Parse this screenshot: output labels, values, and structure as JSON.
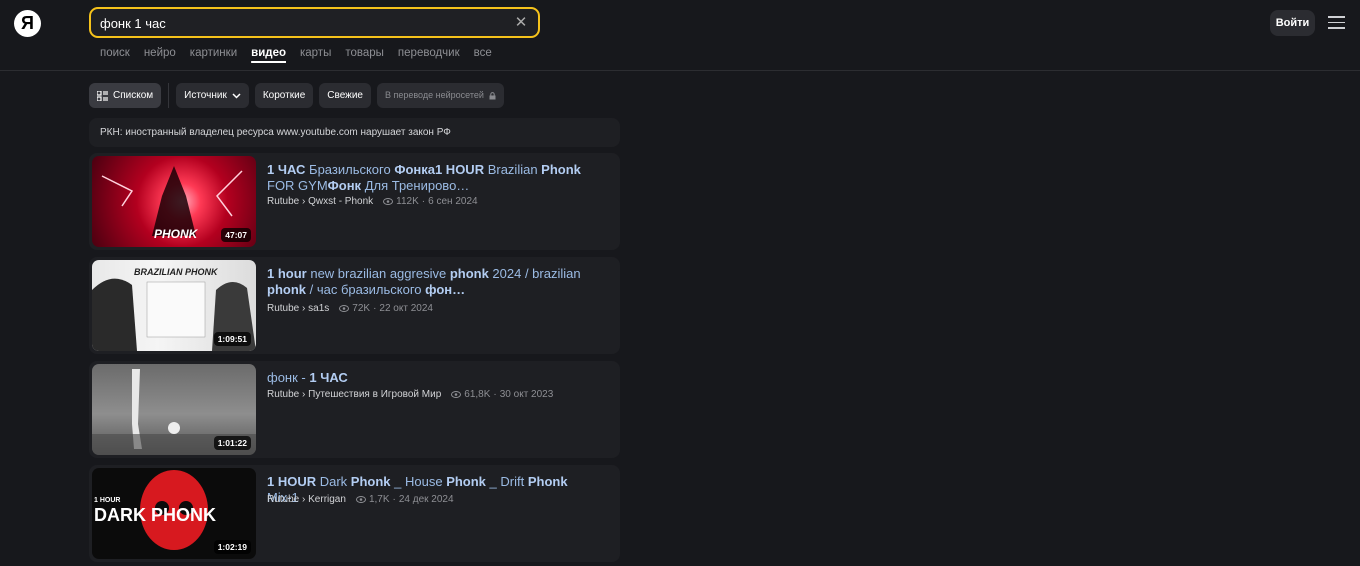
{
  "logo": "Я",
  "search": {
    "value": "фонк 1 час",
    "clear_icon": "✕"
  },
  "tabs": [
    "поиск",
    "нейро",
    "картинки",
    "видео",
    "карты",
    "товары",
    "переводчик",
    "все"
  ],
  "active_tab": "видео",
  "header": {
    "login_label": "Войти"
  },
  "filters": {
    "list_label": "Списком",
    "source_label": "Источник",
    "short_label": "Короткие",
    "fresh_label": "Свежие",
    "neural_label": "В переводе нейросетей"
  },
  "notice": "РКН: иностранный владелец ресурса www.youtube.com нарушает закон РФ",
  "results": [
    {
      "title_parts": [
        [
          "1 ЧАС",
          true
        ],
        [
          " Бразильского ",
          false
        ],
        [
          "Фонка1 HOUR",
          true
        ],
        [
          " Brazilian ",
          false
        ],
        [
          "Phonk",
          true
        ],
        [
          " FOR GYM",
          false
        ],
        [
          "Фонк",
          true
        ],
        [
          " Для Тренирово…",
          false
        ]
      ],
      "source": "Rutube › Qwxst - Phonk",
      "views": "112K",
      "date": "6 сен 2024",
      "duration": "47:07",
      "thumb_text": "PHONK"
    },
    {
      "title_parts": [
        [
          "1 hour",
          true
        ],
        [
          " new brazilian aggresive ",
          false
        ],
        [
          "phonk",
          true
        ],
        [
          " 2024 / brazilian ",
          false
        ],
        [
          "phonk",
          true
        ],
        [
          " / час бразильского ",
          false
        ],
        [
          "фон…",
          true
        ]
      ],
      "source": "Rutube › sa1s",
      "views": "72K",
      "date": "22 окт 2024",
      "duration": "1:09:51",
      "thumb_text": "BRAZILIAN PHONK"
    },
    {
      "title_parts": [
        [
          "фонк",
          false
        ],
        [
          " - ",
          false
        ],
        [
          "1 ЧАС",
          true
        ]
      ],
      "source": "Rutube › Путешествия в Игровой Мир",
      "views": "61,8K",
      "date": "30 окт 2023",
      "duration": "1:01:22",
      "thumb_text": ""
    },
    {
      "title_parts": [
        [
          "1 HOUR",
          true
        ],
        [
          " Dark ",
          false
        ],
        [
          "Phonk",
          true
        ],
        [
          " _ House ",
          false
        ],
        [
          "Phonk",
          true
        ],
        [
          " _ Drift ",
          false
        ],
        [
          "Phonk",
          true
        ],
        [
          " Mix-1",
          false
        ]
      ],
      "source": "Rutube › Kerrigan",
      "views": "1,7K",
      "date": "24 дек 2024",
      "duration": "1:02:19",
      "thumb_text": "DARK PHONK",
      "thumb_small": "1 HOUR"
    }
  ],
  "colors": {
    "accent": "#f5c21b",
    "link": "#9bbbe4",
    "background": "#17181c"
  }
}
